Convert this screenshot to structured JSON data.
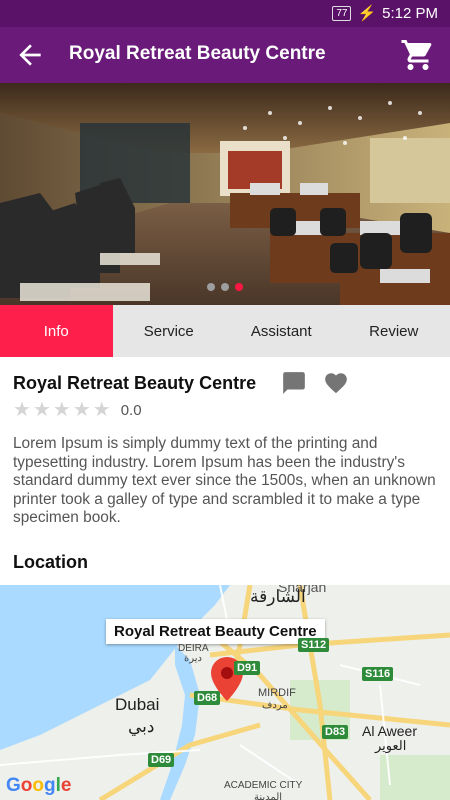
{
  "status_bar": {
    "battery": "77",
    "time": "5:12 PM"
  },
  "app_bar": {
    "title": "Royal Retreat Beauty Centre"
  },
  "tabs": [
    {
      "label": "Info",
      "active": true
    },
    {
      "label": "Service",
      "active": false
    },
    {
      "label": "Assistant",
      "active": false
    },
    {
      "label": "Review",
      "active": false
    }
  ],
  "salon": {
    "name": "Royal Retreat Beauty Centre",
    "rating_value": "0.0",
    "rating_stars": 0,
    "description": "Lorem Ipsum is simply dummy text of the printing and typesetting industry. Lorem Ipsum has been the industry's standard dummy text ever since the 1500s, when an unknown printer took a galley of type and scrambled it to make a type specimen book."
  },
  "location": {
    "heading": "Location",
    "marker_label": "Royal Retreat Beauty Centre",
    "places": {
      "sharjah_en": "Sharjah",
      "sharjah_ar": "الشارقة",
      "deira": "DEIRA",
      "deira_ar": "ديرة",
      "mirdif": "MIRDIF",
      "mirdif_ar": "مردف",
      "dubai": "Dubai",
      "dubai_ar": "دبي",
      "al_aweer": "Al Aweer",
      "al_aweer_ar": "العوير",
      "academic_city": "ACADEMIC CITY",
      "academic_city_ar": "المدينة"
    },
    "roads": [
      "S112",
      "D91",
      "S116",
      "D68",
      "D83",
      "D69"
    ],
    "attribution": "Google"
  },
  "slider": {
    "count": 3,
    "active_index": 2
  },
  "colors": {
    "app_bar": "#6a1b7a",
    "status_bar": "#5a1268",
    "accent": "#ff1f4b"
  }
}
